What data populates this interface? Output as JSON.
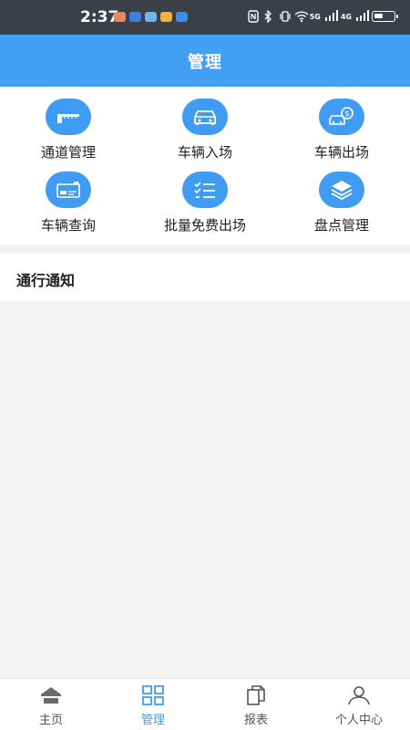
{
  "status_bar": {
    "time": "2:37",
    "signal_5g": "5G",
    "signal_4g": "4G"
  },
  "header": {
    "title": "管理"
  },
  "grid": {
    "items": [
      {
        "label": "通道管理",
        "icon": "barrier-gate-icon"
      },
      {
        "label": "车辆入场",
        "icon": "car-icon"
      },
      {
        "label": "车辆出场",
        "icon": "car-payment-icon"
      },
      {
        "label": "车辆查询",
        "icon": "id-card-icon"
      },
      {
        "label": "批量免费出场",
        "icon": "checklist-icon"
      },
      {
        "label": "盘点管理",
        "icon": "layers-icon"
      }
    ]
  },
  "notice": {
    "title": "通行通知"
  },
  "bottom_nav": {
    "items": [
      {
        "label": "主页",
        "icon": "home-icon",
        "active": false
      },
      {
        "label": "管理",
        "icon": "grid-icon",
        "active": true
      },
      {
        "label": "报表",
        "icon": "report-icon",
        "active": false
      },
      {
        "label": "个人中心",
        "icon": "user-icon",
        "active": false
      }
    ]
  },
  "colors": {
    "accent": "#42a0f4",
    "icon_bg": "#3f9cf2",
    "status_bar": "#3a3f48",
    "background": "#f2f2f2"
  }
}
